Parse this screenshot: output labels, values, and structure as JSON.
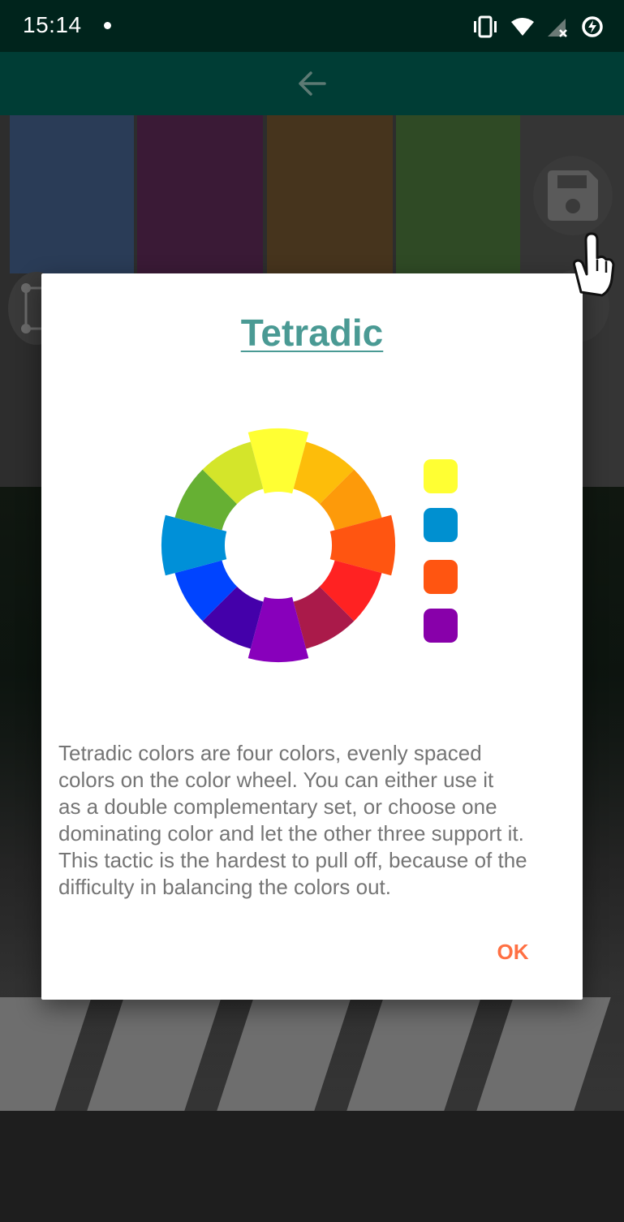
{
  "status_bar": {
    "time": "15:14",
    "icons": [
      "notification-dot-icon",
      "vibrate-icon",
      "wifi-icon",
      "no-signal-icon",
      "battery-saver-icon"
    ]
  },
  "toolbar": {
    "back_icon": "arrow-left-icon"
  },
  "palette_bar": {
    "swatches": [
      "#2a3c57",
      "#3a1a36",
      "#46341d",
      "#2f4a25"
    ],
    "save_icon": "floppy-disk-icon",
    "crop_icon": "crop-frame-icon"
  },
  "dialog": {
    "title": "Tetradic",
    "wheel_segments": [
      "#ffff33",
      "#fdbd0a",
      "#fd9a0a",
      "#ff5511",
      "#ff2222",
      "#aa1a4a",
      "#8800bb",
      "#4400aa",
      "#0044ff",
      "#0090d8",
      "#66b033",
      "#d4e52a"
    ],
    "palette": [
      "#ffff33",
      "#0090d0",
      "#ff5511",
      "#8800aa"
    ],
    "body": "Tetradic colors are four colors, evenly spaced\ncolors on the color wheel. You can either use it\nas a double complementary set, or choose one\ndominating color and let the other three support it.\nThis tactic is the hardest to pull off, because of the\ndifficulty in balancing the colors out.",
    "ok_label": "OK"
  },
  "colors": {
    "title_accent": "#4a9a94",
    "ok_accent": "#ff7043",
    "status_bar": "#00241c",
    "toolbar": "#003d35"
  }
}
